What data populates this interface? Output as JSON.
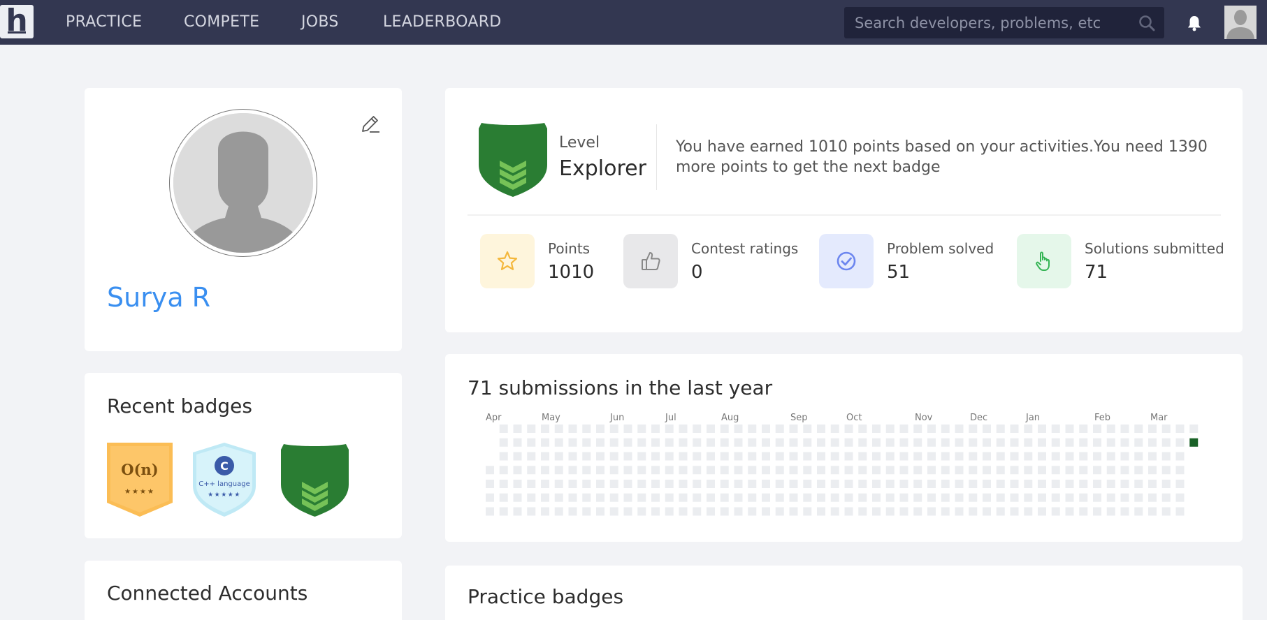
{
  "nav": {
    "logo": "h",
    "links": [
      "PRACTICE",
      "COMPETE",
      "JOBS",
      "LEADERBOARD"
    ],
    "search_placeholder": "Search developers, problems, etc"
  },
  "profile": {
    "name": "Surya R"
  },
  "recent_badges": {
    "title": "Recent badges",
    "items": [
      {
        "name": "O(n)",
        "stars": "★★★★",
        "color": "#fdc669"
      },
      {
        "name": "C++ language",
        "stars": "★★★★★",
        "color": "#d3f1f8"
      },
      {
        "name": "Explorer shield",
        "color": "#2a7d33"
      }
    ]
  },
  "connected_accounts": {
    "title": "Connected Accounts"
  },
  "level": {
    "label": "Level",
    "value": "Explorer",
    "description": "You have earned 1010 points based on your activities.You need 1390 more points to get the next badge"
  },
  "stats": [
    {
      "label": "Points",
      "value": "1010",
      "icon": "star-icon",
      "bg": "#fef5dc",
      "color": "#f4b73b"
    },
    {
      "label": "Contest ratings",
      "value": "0",
      "icon": "thumbs-up-icon",
      "bg": "#e8e8ea",
      "color": "#888"
    },
    {
      "label": "Problem solved",
      "value": "51",
      "icon": "check-circle-icon",
      "bg": "#e4eafd",
      "color": "#6c86ef"
    },
    {
      "label": "Solutions submitted",
      "value": "71",
      "icon": "pointer-hand-icon",
      "bg": "#e5f7ea",
      "color": "#35b455"
    }
  ],
  "submissions": {
    "title": "71 submissions in the last year",
    "months": [
      "Apr",
      "May",
      "Jun",
      "Jul",
      "Aug",
      "Sep",
      "Oct",
      "Nov",
      "Dec",
      "Jan",
      "Feb",
      "Mar"
    ],
    "empty_color": "#ebedf0",
    "active_color": "#196127"
  },
  "practice_badges": {
    "title": "Practice badges"
  }
}
